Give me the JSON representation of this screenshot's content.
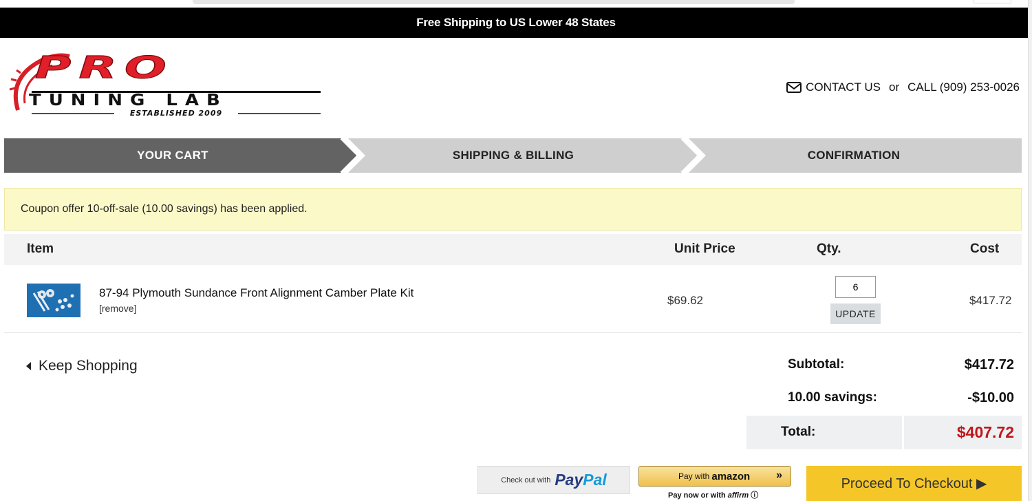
{
  "promo": {
    "text": "Free Shipping to US Lower 48 States"
  },
  "logo": {
    "word1": "PRO",
    "word2": "TUNING LAB",
    "established": "ESTABLISHED 2009"
  },
  "header": {
    "contact_label": "CONTACT US",
    "or": "or",
    "call_label": "CALL (909) 253-0026"
  },
  "steps": [
    {
      "label": "YOUR CART",
      "active": true
    },
    {
      "label": "SHIPPING & BILLING",
      "active": false
    },
    {
      "label": "CONFIRMATION",
      "active": false
    }
  ],
  "coupon": {
    "message": "Coupon offer 10-off-sale (10.00 savings) has been applied."
  },
  "table": {
    "headers": {
      "item": "Item",
      "unit_price": "Unit Price",
      "qty": "Qty.",
      "cost": "Cost"
    },
    "rows": [
      {
        "name": "87-94 Plymouth Sundance Front Alignment Camber Plate Kit",
        "remove": "[remove]",
        "unit_price": "$69.62",
        "qty": "6",
        "update": "UPDATE",
        "cost": "$417.72"
      }
    ]
  },
  "keep_shopping": "Keep Shopping",
  "summary": {
    "subtotal_label": "Subtotal:",
    "subtotal": "$417.72",
    "savings_label": "10.00 savings:",
    "savings": "-$10.00",
    "total_label": "Total:",
    "total": "$407.72"
  },
  "payments": {
    "paypal_prefix": "Check out with",
    "paypal_word1": "Pay",
    "paypal_word2": "Pal",
    "amazon_prefix": "Pay with",
    "amazon_brand": "amazon",
    "amazon_arrows": "»",
    "affirm_prefix": "Pay now or with",
    "affirm_brand": "affirm",
    "checkout_label": "Proceed To Checkout ▶"
  },
  "colors": {
    "total_red": "#c0161a",
    "checkout_yellow": "#f5c627",
    "coupon_bg": "#fbf9c8",
    "step_active": "#636363",
    "step_inactive": "#cfcfcf"
  }
}
